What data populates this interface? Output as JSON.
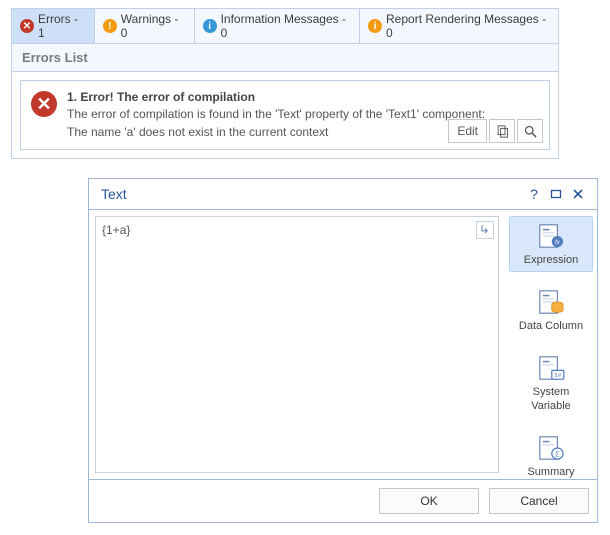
{
  "tabs": {
    "errors": {
      "label": "Errors - 1"
    },
    "warnings": {
      "label": "Warnings - 0"
    },
    "info": {
      "label": "Information Messages - 0"
    },
    "render": {
      "label": "Report Rendering Messages - 0"
    }
  },
  "list": {
    "title": "Errors List",
    "item": {
      "heading": "1. Error!  The error of compilation",
      "line1": "The error of compilation is found in the 'Text' property of the 'Text1' component:",
      "line2": "The name 'a' does not exist in the current context"
    },
    "actions": {
      "edit": "Edit"
    }
  },
  "dialog": {
    "title": "Text",
    "content": "{1+a}",
    "options": {
      "expression": "Expression",
      "datacolumn": "Data Column",
      "sysvar1": "System",
      "sysvar2": "Variable",
      "summary": "Summary"
    },
    "buttons": {
      "ok": "OK",
      "cancel": "Cancel"
    }
  }
}
